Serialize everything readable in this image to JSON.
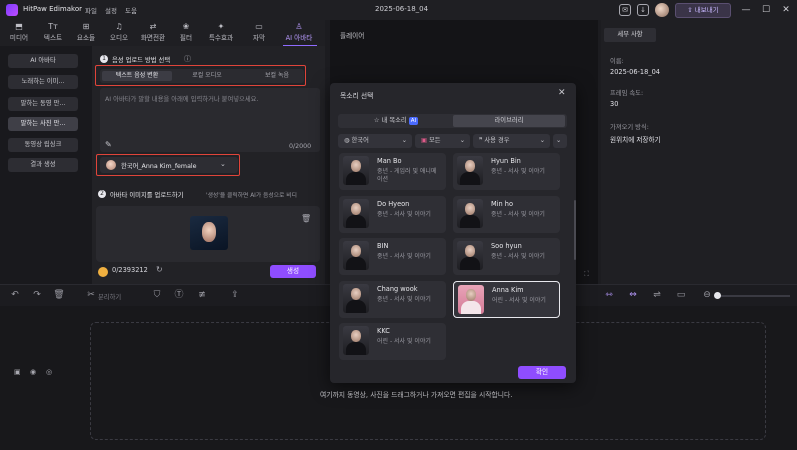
{
  "app": {
    "name": "HitPaw Edimakor",
    "menu": [
      "파일",
      "설정",
      "도움"
    ],
    "project_title": "2025-06-18_04",
    "export_label": "내보내기"
  },
  "toolbar": {
    "items": [
      "미디어",
      "텍스트",
      "요소들",
      "오디오",
      "화면전환",
      "필터",
      "특수효과",
      "자막",
      "AI 아바타"
    ],
    "icons": [
      "media-icon",
      "text-icon",
      "elements-icon",
      "audio-icon",
      "transition-icon",
      "filter-icon",
      "effects-icon",
      "subtitle-icon",
      "ai-avatar-icon"
    ],
    "active_index": 8
  },
  "leftnav": {
    "items": [
      "AI 아바타",
      "노래하는 이미...",
      "말하는 동영 만...",
      "말하는 사진 만...",
      "동영상 립싱크",
      "결과 생성"
    ],
    "active_index": 3
  },
  "ai_panel": {
    "step1": {
      "num": "1",
      "title": "음성 업로드 방법 선택"
    },
    "segment": [
      "텍스트 음성 변환",
      "로컬 오디오",
      "보컬 녹음"
    ],
    "text_placeholder": "AI 아바타가 말할 내용을 아래에 입력하거나 붙여넣으세요.",
    "counter": "0/2000",
    "voice_selected": "한국어_Anna Kim_female",
    "step2": {
      "num": "2",
      "title": "아바타 이미지를 업로드하기",
      "hint": "'생성'을 클릭하면 AI가 음성으로 비디"
    },
    "credits": "0/2393212",
    "generate_label": "생성"
  },
  "player": {
    "label": "플레이어"
  },
  "properties": {
    "tab": "세부 사항",
    "rows": [
      {
        "key": "이름:",
        "value": "2025-06-18_04"
      },
      {
        "key": "프레임 속도:",
        "value": "30"
      },
      {
        "key": "가져오기 방식:",
        "value": "원위치에 저장하기"
      }
    ]
  },
  "timeline": {
    "split_label": "분리하기",
    "drop_text": "여기까지 동영상, 사진을 드래그하거나 가져오면 편집을 시작합니다."
  },
  "voice_modal": {
    "title": "목소리 선택",
    "tabs": [
      "내 목소리",
      "라이브러리"
    ],
    "ai_badge": "AI",
    "filters": [
      "한국어",
      "모든",
      "사용 경우"
    ],
    "voices": [
      {
        "name": "Man Bo",
        "desc": "중년 - 게임러 및 애니메이션",
        "gender": "male",
        "selected": false
      },
      {
        "name": "Hyun Bin",
        "desc": "중년 - 서사 및 이야기",
        "gender": "male",
        "selected": false
      },
      {
        "name": "Do Hyeon",
        "desc": "중년 - 서사 및 이야기",
        "gender": "male",
        "selected": false
      },
      {
        "name": "Min ho",
        "desc": "중년 - 서사 및 이야기",
        "gender": "male",
        "selected": false
      },
      {
        "name": "BIN",
        "desc": "중년 - 서사 및 이야기",
        "gender": "male",
        "selected": false
      },
      {
        "name": "Soo hyun",
        "desc": "중년 - 서사 및 이야기",
        "gender": "male",
        "selected": false
      },
      {
        "name": "Chang wook",
        "desc": "중년 - 서사 및 이야기",
        "gender": "male",
        "selected": false
      },
      {
        "name": "Anna Kim",
        "desc": "어린 - 서사 및 이야기",
        "gender": "female",
        "selected": true
      },
      {
        "name": "KKC",
        "desc": "어린 - 서사 및 이야기",
        "gender": "male",
        "selected": false
      }
    ],
    "confirm_label": "확인"
  },
  "colors": {
    "accent": "#8f4dff",
    "highlight_box": "#e0443a"
  }
}
